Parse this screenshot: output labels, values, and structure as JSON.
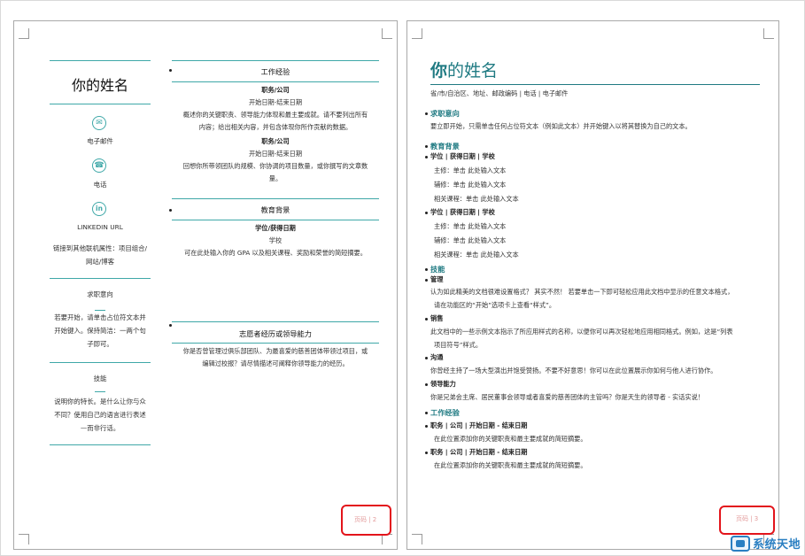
{
  "left_page": {
    "sidebar": {
      "name": "你的姓名",
      "email_label": "电子邮件",
      "phone_label": "电话",
      "linkedin_label": "LINKEDIN URL",
      "links_text": [
        "链接到其他联机属性：项目组合/",
        "网站/博客"
      ],
      "objective_title": "求职意向",
      "objective_text": [
        "若要开始，请单击占位符文本并",
        "开始键入。保持简洁：一两个句",
        "子即可。"
      ],
      "skills_title": "技能",
      "skills_text": [
        "说明你的特长。是什么让你与众",
        "不同？使用自己的语言进行表述",
        "—而非行话。"
      ]
    },
    "experience": {
      "title": "工作经验",
      "jobs": [
        {
          "title": "职务/公司",
          "dates": "开始日期-结束日期",
          "description": [
            "概述你的关键职责、领导能力体现和最主要成就。请不要列出所有",
            "内容；给出相关内容，并包含体现你所作贡献的数据。"
          ]
        },
        {
          "title": "职务/公司",
          "dates": "开始日期-结束日期",
          "description": [
            "回想你所带领团队的规模、你协调的项目数量，或你撰写的文章数",
            "量。"
          ]
        }
      ]
    },
    "education": {
      "title": "教育背景",
      "degree": "学位/获得日期",
      "school": "学校",
      "description": "可在此处输入你的 GPA 以及相关课程、奖励和荣誉的简短摘要。"
    },
    "volunteer": {
      "title": "志愿者经历或领导能力",
      "description": [
        "你是否曾管理过俱乐部团队、为最喜爱的慈善团体带领过项目，或",
        "编辑过校报？请尽情描述可阐释你领导能力的经历。"
      ]
    },
    "footer": "页码 | 2"
  },
  "right_page": {
    "name_first": "你",
    "name_rest": "的姓名",
    "contact": "省/市/自治区、地址、邮政编码 | 电话 | 电子邮件",
    "objective": {
      "title": "求职意向",
      "text": "要立即开始，只需单击任何占位符文本（例如此文本）并开始键入以将其替换为自己的文本。"
    },
    "education": {
      "title": "教育背景",
      "entries": [
        {
          "heading": "学位 | 获得日期 | 学校",
          "major": "主修：单击 此处输入文本",
          "minor": "辅修：单击 此处输入文本",
          "courses": "相关课程：单击 此处输入文本"
        },
        {
          "heading": "学位 | 获得日期 | 学校",
          "major": "主修：单击 此处输入文本",
          "minor": "辅修：单击 此处输入文本",
          "courses": "相关课程：单击 此处输入文本"
        }
      ]
    },
    "skills": {
      "title": "技能",
      "items": [
        {
          "title": "管理",
          "lines": [
            "认为如此精美的文档很难设置格式？ 其实不然！ 若要单击一下即可轻松应用此文档中显示的任意文本格式，",
            "请在功能区的“开始”选项卡上查看“样式”。"
          ]
        },
        {
          "title": "销售",
          "lines": [
            "此文档中的一些示例文本指示了所应用样式的名称，以便你可以再次轻松地应用相同格式。例如，这是“列表",
            "项目符号”样式。"
          ]
        },
        {
          "title": "沟通",
          "lines": [
            "你曾经主持了一场大型演出并饱受赞扬。不要不好意思！你可以在此位置展示你如何与他人进行协作。"
          ]
        },
        {
          "title": "领导能力",
          "lines": [
            "你是兄弟会主席、居民董事会领导或者喜爱的慈善团体的主管吗？你是天生的领导者 - 实话实说！"
          ]
        }
      ]
    },
    "experience": {
      "title": "工作经验",
      "jobs": [
        {
          "heading": "职务 | 公司 | 开始日期 - 结束日期",
          "text": "在此位置添加你的关键职责和最主要成就的简短摘要。"
        },
        {
          "heading": "职务 | 公司 | 开始日期 - 结束日期",
          "text": "在此位置添加你的关键职责和最主要成就的简短摘要。"
        }
      ]
    },
    "footer": "页码 | 3"
  },
  "watermark": {
    "text": "系统天地"
  },
  "colors": {
    "accent": "#1f7a82",
    "rule": "#3fa8a8",
    "highlight": "#e3141b",
    "footer": "#e39b9b"
  },
  "icons": [
    "envelope-icon",
    "phone-icon",
    "linkedin-icon"
  ]
}
